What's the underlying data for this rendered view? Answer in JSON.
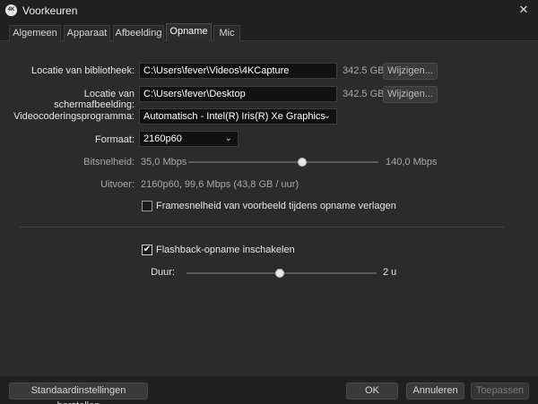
{
  "window": {
    "title": "Voorkeuren",
    "icon_text": "4K",
    "close_glyph": "✕"
  },
  "tabs": [
    {
      "label": "Algemeen",
      "active": false
    },
    {
      "label": "Apparaat",
      "active": false
    },
    {
      "label": "Afbeelding",
      "active": false
    },
    {
      "label": "Opname",
      "active": true
    },
    {
      "label": "Mic",
      "active": false
    }
  ],
  "library": {
    "label": "Locatie van bibliotheek:",
    "value": "C:\\Users\\fever\\Videos\\4KCapture",
    "size": "342.5 GB",
    "button": "Wijzigen..."
  },
  "screenshot": {
    "label": "Locatie van schermafbeelding:",
    "value": "C:\\Users\\fever\\Desktop",
    "size": "342.5 GB",
    "button": "Wijzigen..."
  },
  "encoder": {
    "label": "Videocoderingsprogramma:",
    "value": "Automatisch - Intel(R) Iris(R) Xe Graphics"
  },
  "format": {
    "label": "Formaat:",
    "value": "2160p60"
  },
  "bitrate": {
    "label": "Bitsnelheid:",
    "min": "35,0 Mbps",
    "max": "140,0 Mbps",
    "level": 0.6
  },
  "output": {
    "label": "Uitvoer:",
    "value": "2160p60, 99,6 Mbps (43,8 GB / uur)"
  },
  "lower_framerate": {
    "label": "Framesnelheid van voorbeeld tijdens opname verlagen",
    "checked": false
  },
  "flashback": {
    "label": "Flashback-opname inschakelen",
    "checked": true,
    "check_glyph": "✔"
  },
  "duration": {
    "label": "Duur:",
    "value": "2 u",
    "level": 0.49
  },
  "footer": {
    "reset_button": "Standaardinstellingen herstellen",
    "ok_button": "OK",
    "cancel_button": "Annuleren",
    "apply_button": "Toepassen"
  }
}
